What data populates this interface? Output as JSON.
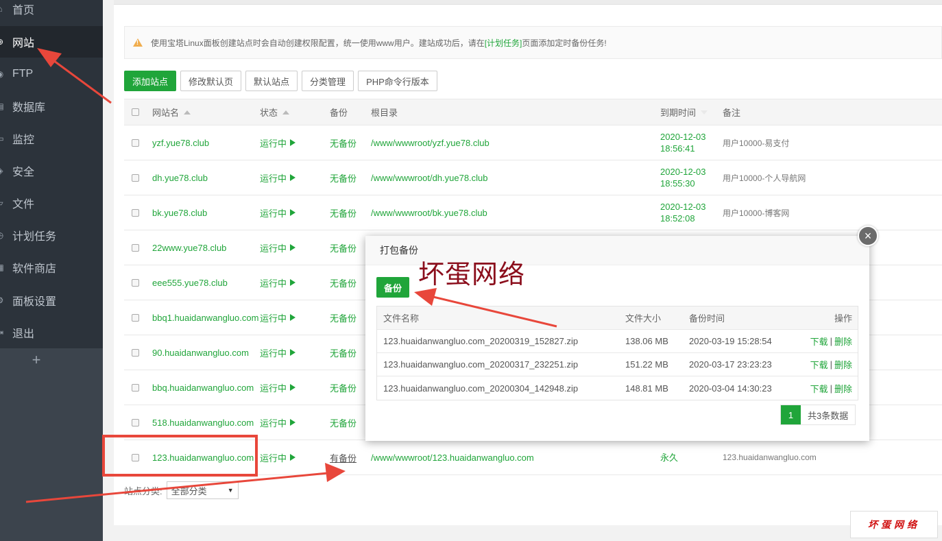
{
  "sidebar": {
    "items": [
      {
        "label": "首页",
        "icon": "home-icon"
      },
      {
        "label": "网站",
        "icon": "globe-icon"
      },
      {
        "label": "FTP",
        "icon": "ftp-icon"
      },
      {
        "label": "数据库",
        "icon": "database-icon"
      },
      {
        "label": "监控",
        "icon": "monitor-icon"
      },
      {
        "label": "安全",
        "icon": "shield-icon"
      },
      {
        "label": "文件",
        "icon": "folder-icon"
      },
      {
        "label": "计划任务",
        "icon": "clock-icon"
      },
      {
        "label": "软件商店",
        "icon": "store-icon"
      },
      {
        "label": "面板设置",
        "icon": "settings-icon"
      },
      {
        "label": "退出",
        "icon": "logout-icon"
      }
    ],
    "active_index": 1,
    "add_label": "+"
  },
  "notice": {
    "text_before": "使用宝塔Linux面板创建站点时会自动创建权限配置，统一使用www用户。建站成功后，请在",
    "link": "[计划任务]",
    "text_after": "页面添加定时备份任务!"
  },
  "toolbar": {
    "add_site": "添加站点",
    "edit_default_page": "修改默认页",
    "default_site": "默认站点",
    "category_manage": "分类管理",
    "php_cli_version": "PHP命令行版本"
  },
  "table": {
    "headers": {
      "name": "网站名",
      "status": "状态",
      "backup": "备份",
      "root": "根目录",
      "expire": "到期时间",
      "remark": "备注"
    },
    "rows": [
      {
        "name": "yzf.yue78.club",
        "status": "运行中",
        "backup": "无备份",
        "root": "/www/wwwroot/yzf.yue78.club",
        "expire_date": "2020-12-03",
        "expire_time": "18:56:41",
        "remark": "用户10000-易支付"
      },
      {
        "name": "dh.yue78.club",
        "status": "运行中",
        "backup": "无备份",
        "root": "/www/wwwroot/dh.yue78.club",
        "expire_date": "2020-12-03",
        "expire_time": "18:55:30",
        "remark": "用户10000-个人导航网"
      },
      {
        "name": "bk.yue78.club",
        "status": "运行中",
        "backup": "无备份",
        "root": "/www/wwwroot/bk.yue78.club",
        "expire_date": "2020-12-03",
        "expire_time": "18:52:08",
        "remark": "用户10000-博客网"
      },
      {
        "name": "22www.yue78.club",
        "status": "运行中",
        "backup": "无备份",
        "root": "",
        "expire_date": "",
        "expire_time": "",
        "remark": ""
      },
      {
        "name": "eee555.yue78.club",
        "status": "运行中",
        "backup": "无备份",
        "root": "",
        "expire_date": "",
        "expire_time": "",
        "remark": ""
      },
      {
        "name": "bbq1.huaidanwangluo.com",
        "status": "运行中",
        "backup": "无备份",
        "root": "",
        "expire_date": "",
        "expire_time": "",
        "remark": ""
      },
      {
        "name": "90.huaidanwangluo.com",
        "status": "运行中",
        "backup": "无备份",
        "root": "",
        "expire_date": "",
        "expire_time": "",
        "remark": ""
      },
      {
        "name": "bbq.huaidanwangluo.com",
        "status": "运行中",
        "backup": "无备份",
        "root": "",
        "expire_date": "",
        "expire_time": "",
        "remark": ""
      },
      {
        "name": "518.huaidanwangluo.com",
        "status": "运行中",
        "backup": "无备份",
        "root": "",
        "expire_date": "",
        "expire_time": "",
        "remark": ""
      },
      {
        "name": "123.huaidanwangluo.com",
        "status": "运行中",
        "backup": "有备份",
        "root": "/www/wwwroot/123.huaidanwangluo.com",
        "expire_date": "永久",
        "expire_time": "",
        "remark": "123.huaidanwangluo.com"
      }
    ]
  },
  "category": {
    "label": "站点分类:",
    "selected": "全部分类"
  },
  "dialog": {
    "title": "打包备份",
    "close": "×",
    "backup_button": "备份",
    "headers": {
      "file": "文件名称",
      "size": "文件大小",
      "time": "备份时间",
      "ops": "操作"
    },
    "rows": [
      {
        "file": "123.huaidanwangluo.com_20200319_152827.zip",
        "size": "138.06 MB",
        "time": "2020-03-19 15:28:54",
        "download": "下载",
        "delete": "删除"
      },
      {
        "file": "123.huaidanwangluo.com_20200317_232251.zip",
        "size": "151.22 MB",
        "time": "2020-03-17 23:23:23",
        "download": "下载",
        "delete": "删除"
      },
      {
        "file": "123.huaidanwangluo.com_20200304_142948.zip",
        "size": "148.81 MB",
        "time": "2020-03-04 14:30:23",
        "download": "下载",
        "delete": "删除"
      }
    ],
    "page": "1",
    "total": "共3条数据"
  },
  "watermark": {
    "title": "坏蛋网络",
    "logo": "坏蛋网络"
  },
  "colors": {
    "accent": "#20a53a",
    "sidebar": "#2c333b",
    "annotation": "#e8473b"
  }
}
